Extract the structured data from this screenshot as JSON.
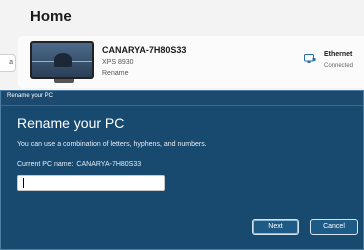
{
  "settings": {
    "page_title": "Home",
    "search_stub": "a",
    "device": {
      "name": "CANARYA-7H80S33",
      "model": "XPS 8930",
      "rename_label": "Rename"
    },
    "network": {
      "title": "Ethernet",
      "status": "Connected",
      "icon": "monitor-network-icon"
    }
  },
  "dialog": {
    "titlebar": "Rename your PC",
    "heading": "Rename your PC",
    "description": "You can use a combination of letters, hyphens, and numbers.",
    "current_label": "Current PC name:",
    "current_value": "CANARYA-7H80S33",
    "input_value": "",
    "next_label": "Next",
    "cancel_label": "Cancel"
  },
  "colors": {
    "dialog_bg": "#18496f",
    "accent": "#1e5a86"
  }
}
